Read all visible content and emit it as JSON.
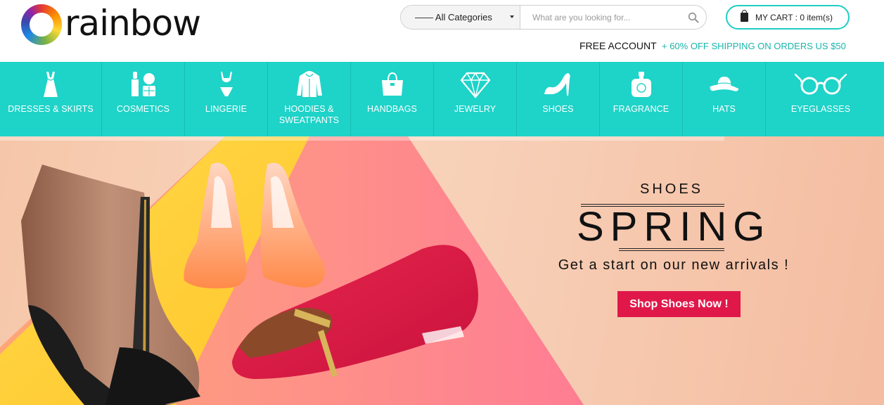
{
  "brand": {
    "name": "rainbow"
  },
  "search": {
    "category": "—— All Categories",
    "placeholder": "What are you looking for..."
  },
  "cart": {
    "label": "MY CART : 0 item(s)"
  },
  "topbar": {
    "free_account": "FREE ACCOUNT",
    "promo": "+ 60% OFF SHIPPING ON ORDERS US $50"
  },
  "nav": {
    "items": [
      {
        "label": "DRESSES & SKIRTS",
        "icon": "dress-icon"
      },
      {
        "label": "COSMETICS",
        "icon": "cosmetics-icon"
      },
      {
        "label": "LINGERIE",
        "icon": "lingerie-icon"
      },
      {
        "label": "HOODIES & SWEATPANTS",
        "icon": "hoodie-icon"
      },
      {
        "label": "HANDBAGS",
        "icon": "handbag-icon"
      },
      {
        "label": "JEWELRY",
        "icon": "diamond-icon"
      },
      {
        "label": "SHOES",
        "icon": "high-heel-icon"
      },
      {
        "label": "FRAGRANCE",
        "icon": "perfume-icon"
      },
      {
        "label": "HATS",
        "icon": "hat-icon"
      },
      {
        "label": "EYEGLASSES",
        "icon": "eyeglasses-icon"
      }
    ]
  },
  "hero": {
    "kicker": "SHOES",
    "title": "SPRING",
    "subtitle": "Get a start on our new arrivals !",
    "cta": "Shop Shoes Now !"
  },
  "colors": {
    "accent": "#1ed3c8",
    "cta": "#e0184a",
    "promo_text": "#1ab5ab"
  }
}
